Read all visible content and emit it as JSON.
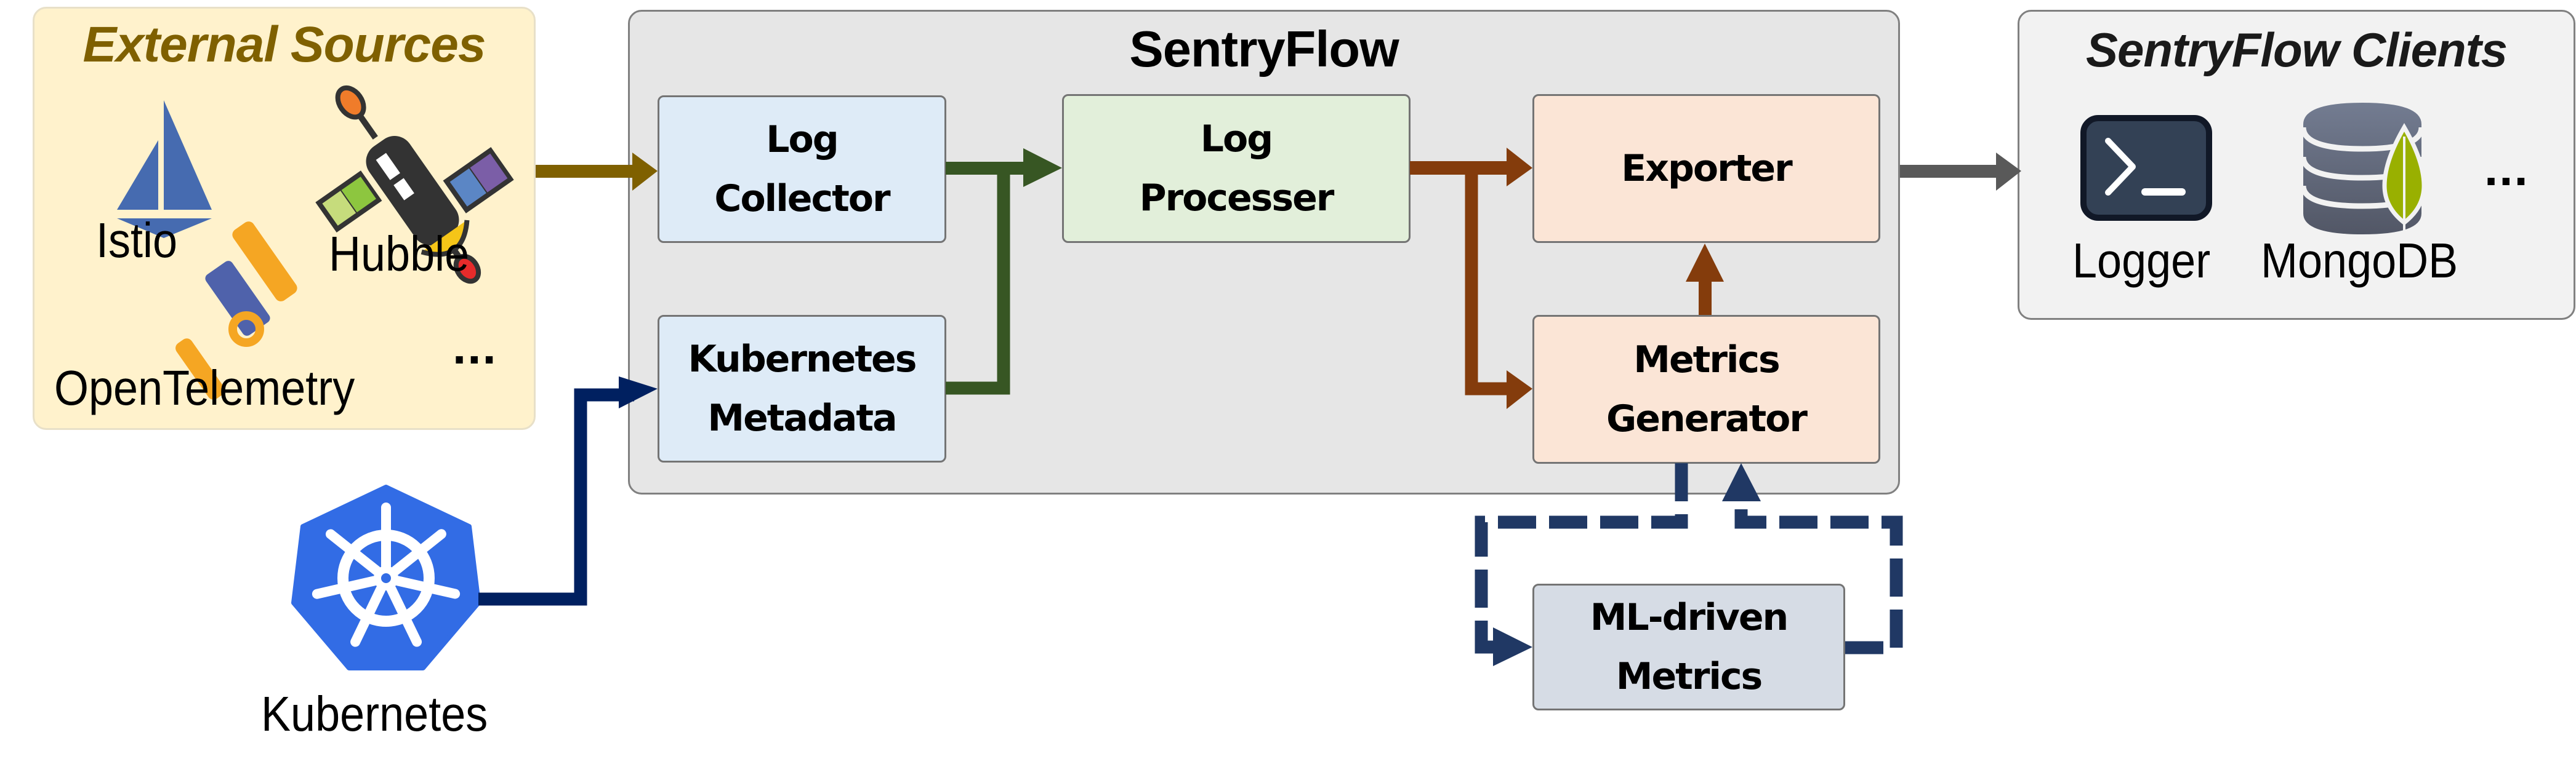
{
  "diagram": {
    "external_sources": {
      "title": "External Sources",
      "items": [
        {
          "label": "Istio",
          "icon": "istio-sail-icon"
        },
        {
          "label": "Hubble",
          "icon": "hubble-satellite-icon"
        },
        {
          "label": "OpenTelemetry",
          "icon": "opentelemetry-telescope-icon"
        }
      ],
      "more": "..."
    },
    "kubernetes": {
      "label": "Kubernetes",
      "icon": "kubernetes-helm-icon"
    },
    "sentryflow": {
      "title": "SentryFlow",
      "components": {
        "log_collector": [
          "Log",
          "Collector"
        ],
        "kubernetes_metadata": [
          "Kubernetes",
          "Metadata"
        ],
        "log_processer": [
          "Log",
          "Processer"
        ],
        "exporter": [
          "Exporter"
        ],
        "metrics_generator": [
          "Metrics",
          "Generator"
        ]
      }
    },
    "ml_driven_metrics": [
      "ML-driven",
      "Metrics"
    ],
    "clients": {
      "title": "SentryFlow Clients",
      "items": [
        {
          "label": "Logger",
          "icon": "terminal-icon"
        },
        {
          "label": "MongoDB",
          "icon": "mongodb-database-icon"
        }
      ],
      "more": "..."
    },
    "edges": [
      {
        "from": "external_sources",
        "to": "log_collector",
        "style": "solid",
        "color": "#7F6000"
      },
      {
        "from": "kubernetes",
        "to": "kubernetes_metadata",
        "style": "solid",
        "color": "#002060"
      },
      {
        "from": "log_collector",
        "to": "log_processer",
        "style": "solid",
        "color": "#375623"
      },
      {
        "from": "kubernetes_metadata",
        "to": "log_processer",
        "style": "solid",
        "color": "#375623"
      },
      {
        "from": "log_processer",
        "to": "exporter",
        "style": "solid",
        "color": "#843C0C"
      },
      {
        "from": "log_processer",
        "to": "metrics_generator",
        "style": "solid",
        "color": "#843C0C"
      },
      {
        "from": "metrics_generator",
        "to": "exporter",
        "style": "solid",
        "color": "#843C0C"
      },
      {
        "from": "metrics_generator",
        "to": "ml_driven_metrics",
        "style": "dashed",
        "color": "#203864"
      },
      {
        "from": "ml_driven_metrics",
        "to": "metrics_generator",
        "style": "dashed",
        "color": "#203864"
      },
      {
        "from": "sentryflow",
        "to": "clients",
        "style": "solid",
        "color": "#595959"
      }
    ]
  },
  "colors": {
    "external_fill": "#FFF2CC",
    "external_title": "#7F6000",
    "sentryflow_fill": "#E6E6E6",
    "clients_fill": "#F2F2F2",
    "collector_fill": "#DEEBF7",
    "processer_fill": "#E2EFDA",
    "exporter_fill": "#FBE5D6",
    "ml_fill": "#D6DCE5"
  }
}
